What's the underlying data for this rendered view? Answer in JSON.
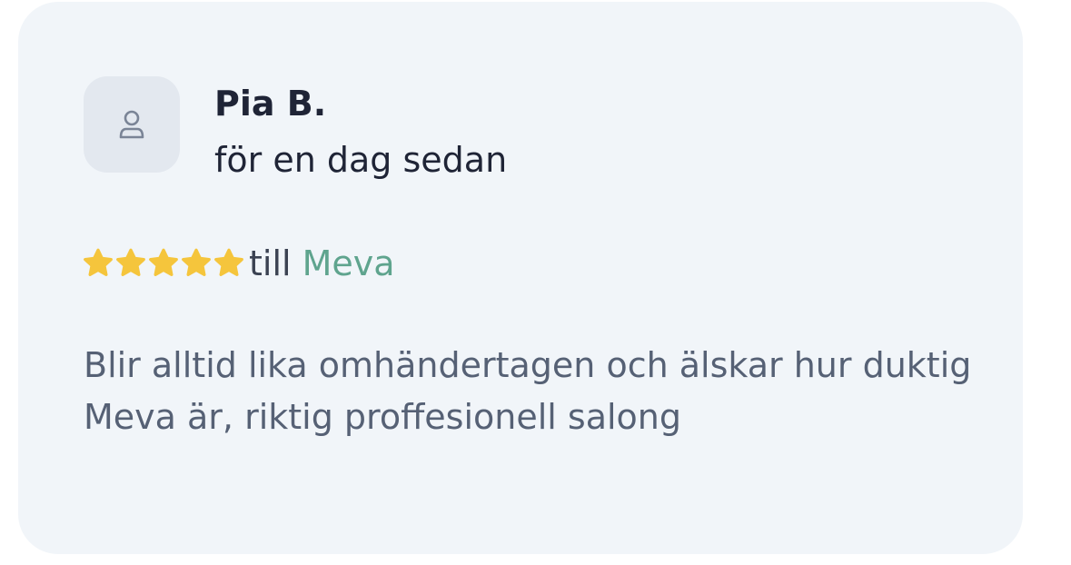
{
  "review": {
    "reviewer_name": "Pia B.",
    "time_ago": "för en dag sedan",
    "rating": {
      "value": 5,
      "max": 5
    },
    "till_label": "till",
    "salon_name": "Meva",
    "body": "Blir alltid lika omhändertagen och älskar hur duktig Meva är, riktig proffesionell salong"
  },
  "icons": {
    "avatar": "user-icon",
    "star": "star-icon"
  },
  "colors": {
    "card_background": "#f1f5f9",
    "avatar_background": "#e3e8ef",
    "star": "#f5c53c",
    "salon_link": "#5fa48e",
    "name_text": "#1f2436",
    "body_text": "#566175"
  }
}
